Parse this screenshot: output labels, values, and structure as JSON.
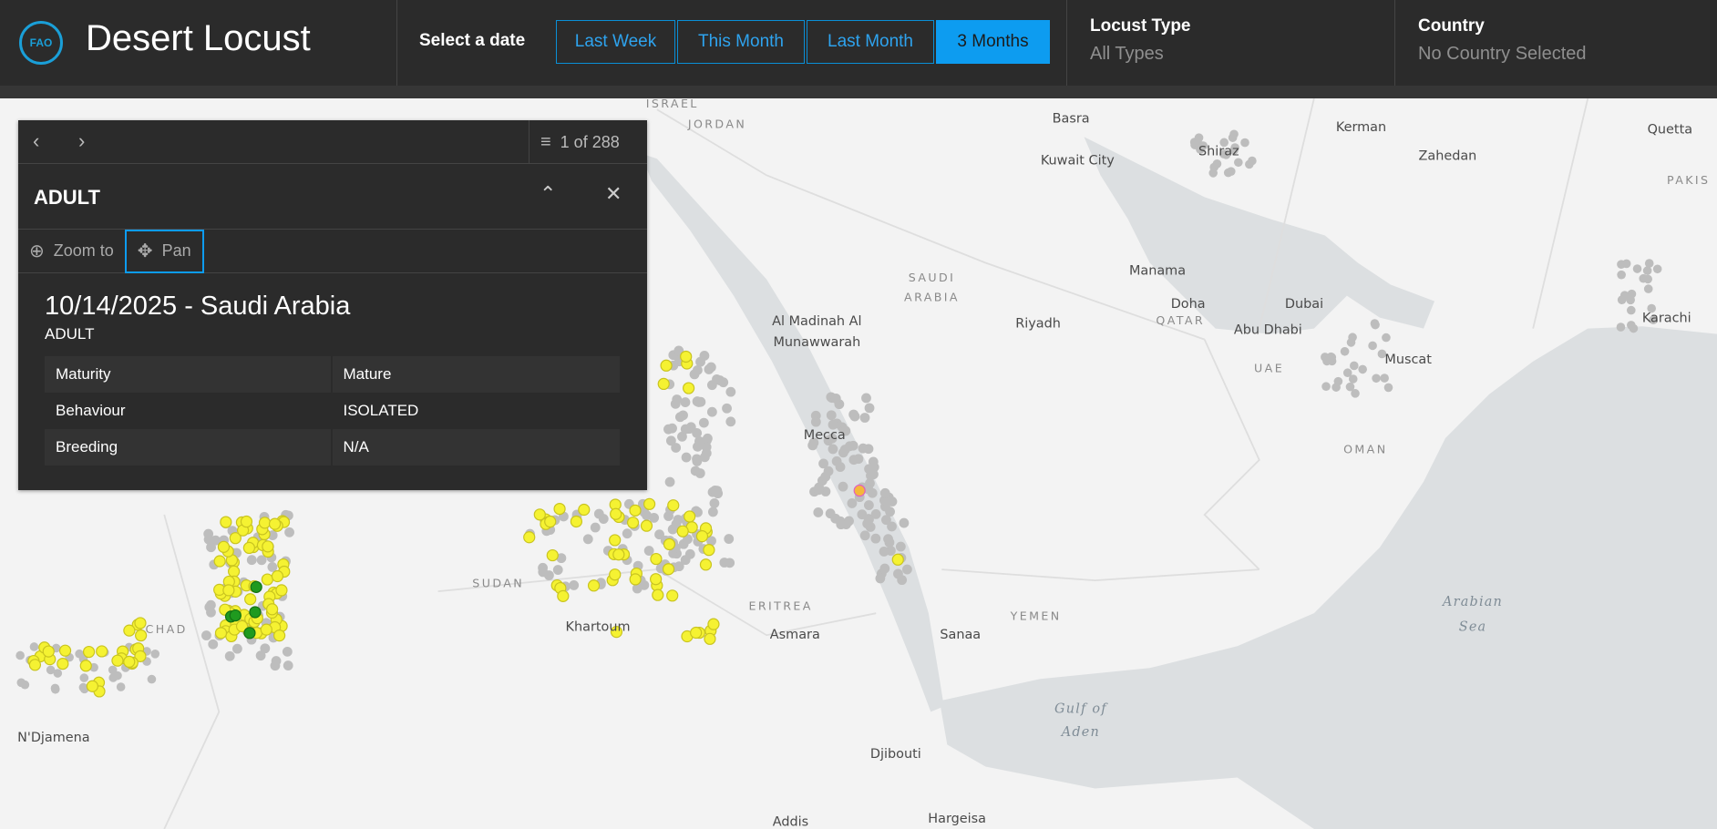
{
  "header": {
    "logo_text": "FAO",
    "title": "Desert Locust",
    "select_date_label": "Select a date",
    "date_buttons": [
      {
        "label": "Last Week",
        "active": false
      },
      {
        "label": "This Month",
        "active": false
      },
      {
        "label": "Last Month",
        "active": false
      },
      {
        "label": "3 Months",
        "active": true
      }
    ],
    "locust_type": {
      "label": "Locust Type",
      "value": "All Types"
    },
    "country": {
      "label": "Country",
      "value": "No Country Selected"
    }
  },
  "popup": {
    "count": "1 of 288",
    "title": "ADULT",
    "actions": {
      "zoom_to": "Zoom to",
      "pan": "Pan"
    },
    "heading": "10/14/2025 - Saudi Arabia",
    "subheading": "ADULT",
    "fields": [
      {
        "name": "Maturity",
        "value": "Mature"
      },
      {
        "name": "Behaviour",
        "value": "ISOLATED"
      },
      {
        "name": "Breeding",
        "value": "N/A"
      }
    ]
  },
  "map": {
    "cities": [
      "Basra",
      "Kerman",
      "Quetta",
      "Shiraz",
      "Kuwait City",
      "Zahedan",
      "Manama",
      "Al Madinah Al",
      "Munawwarah",
      "Riyadh",
      "Doha",
      "Dubai",
      "Abu Dhabi",
      "Karachi",
      "Muscat",
      "Mecca",
      "Khartoum",
      "Asmara",
      "Sanaa",
      "N'Djamena",
      "Djibouti",
      "Addis",
      "Hargeisa"
    ],
    "countries": [
      "ISRAEL",
      "JORDAN",
      "PAKIS",
      "SAUDI",
      "ARABIA",
      "QATAR",
      "UAE",
      "OMAN",
      "SUDAN",
      "YEMEN",
      "CHAD",
      "ERITREA"
    ],
    "seas": [
      "Arabian",
      "Sea",
      "Gulf of",
      "Aden"
    ],
    "colors": {
      "adult": "#f5f232",
      "hopper": "#1f9a1f",
      "selected": "#e05fc0",
      "history": "#bdbdbd"
    }
  }
}
